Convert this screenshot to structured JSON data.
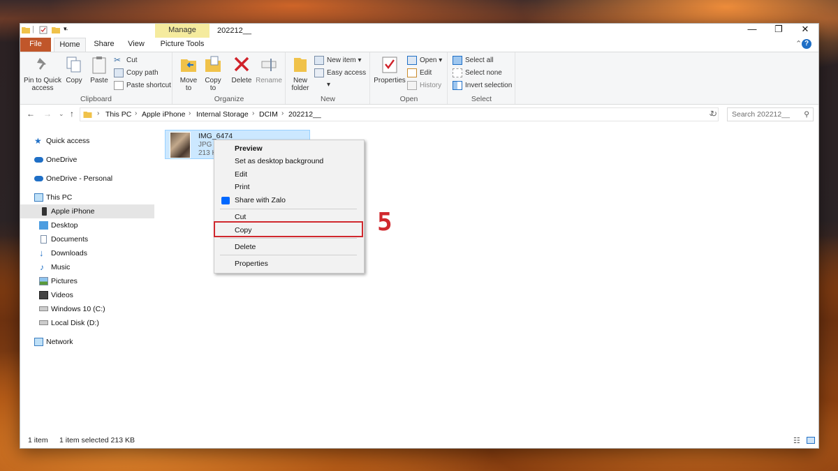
{
  "window": {
    "title": "202212__",
    "context_tab_group": "Manage",
    "controls": {
      "minimize": "—",
      "maximize": "❐",
      "close": "✕"
    }
  },
  "ribbon_tabs": [
    "File",
    "Home",
    "Share",
    "View",
    "Picture Tools"
  ],
  "ribbon": {
    "clipboard": {
      "label": "Clipboard",
      "pin": "Pin to Quick access",
      "copy": "Copy",
      "paste": "Paste",
      "cut": "Cut",
      "copy_path": "Copy path",
      "paste_shortcut": "Paste shortcut"
    },
    "organize": {
      "label": "Organize",
      "move_to": "Move to",
      "copy_to": "Copy to",
      "delete": "Delete",
      "rename": "Rename"
    },
    "new": {
      "label": "New",
      "new_folder": "New folder",
      "new_item": "New item",
      "easy_access": "Easy access"
    },
    "open": {
      "label": "Open",
      "properties": "Properties",
      "open": "Open",
      "edit": "Edit",
      "history": "History"
    },
    "select": {
      "label": "Select",
      "select_all": "Select all",
      "select_none": "Select none",
      "invert_selection": "Invert selection"
    }
  },
  "address": {
    "crumbs": [
      "This PC",
      "Apple iPhone",
      "Internal Storage",
      "DCIM",
      "202212__"
    ],
    "search_placeholder": "Search 202212__"
  },
  "sidebar": [
    {
      "label": "Quick access",
      "icon": "star-icon"
    },
    {
      "label": "OneDrive",
      "icon": "cloud-icon"
    },
    {
      "label": "OneDrive - Personal",
      "icon": "cloud-icon"
    },
    {
      "label": "This PC",
      "icon": "computer-icon"
    },
    {
      "label": "Apple iPhone",
      "icon": "phone-icon",
      "selected": true
    },
    {
      "label": "Desktop",
      "icon": "desktop-icon"
    },
    {
      "label": "Documents",
      "icon": "document-icon"
    },
    {
      "label": "Downloads",
      "icon": "download-icon"
    },
    {
      "label": "Music",
      "icon": "music-icon"
    },
    {
      "label": "Pictures",
      "icon": "pictures-icon"
    },
    {
      "label": "Videos",
      "icon": "video-icon"
    },
    {
      "label": "Windows 10 (C:)",
      "icon": "drive-icon"
    },
    {
      "label": "Local Disk (D:)",
      "icon": "drive-icon"
    },
    {
      "label": "Network",
      "icon": "network-icon"
    }
  ],
  "file": {
    "name": "IMG_6474",
    "type": "JPG F",
    "size": "213 K"
  },
  "context_menu": {
    "items": [
      "Preview",
      "Set as desktop background",
      "Edit",
      "Print",
      "Share with Zalo",
      "Cut",
      "Copy",
      "Delete",
      "Properties"
    ],
    "highlighted": "Copy"
  },
  "annotation": "5",
  "status": {
    "count": "1 item",
    "selected": "1 item selected  213 KB"
  },
  "colors": {
    "file_tab": "#c0562a",
    "manage": "#f5eb9e",
    "selection": "#cce8ff",
    "highlight_box": "#d0282e"
  }
}
